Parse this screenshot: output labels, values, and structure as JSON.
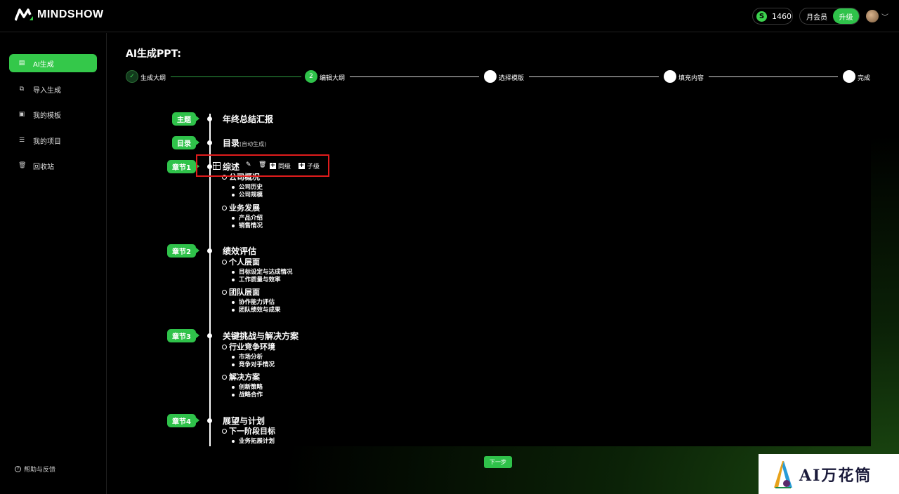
{
  "header": {
    "logo_text": "MINDSHOW",
    "credits": "1460",
    "credit_icon": "S",
    "membership": "月会员",
    "upgrade": "升级"
  },
  "sidebar": {
    "items": [
      {
        "label": "AI生成",
        "icon": "document-icon"
      },
      {
        "label": "导入生成",
        "icon": "import-icon"
      },
      {
        "label": "我的模板",
        "icon": "template-icon"
      },
      {
        "label": "我的项目",
        "icon": "list-icon"
      },
      {
        "label": "回收站",
        "icon": "trash-icon"
      }
    ],
    "help": "帮助与反馈"
  },
  "main": {
    "title": "AI生成PPT:",
    "steps": [
      {
        "label": "生成大纲",
        "mark": "✓",
        "state": "done"
      },
      {
        "label": "编辑大纲",
        "mark": "2",
        "state": "current"
      },
      {
        "label": "选择模版",
        "mark": "",
        "state": "todo"
      },
      {
        "label": "填充内容",
        "mark": "",
        "state": "todo"
      },
      {
        "label": "完成",
        "mark": "",
        "state": "todo"
      }
    ],
    "outline": {
      "topic_tag": "主题",
      "topic": "年终总结汇报",
      "toc_tag": "目录",
      "toc": "目录",
      "toc_note": "(自动生成)",
      "chapters": [
        {
          "tag": "章节1",
          "title": "综述",
          "sections": [
            {
              "title": "公司概况",
              "items": [
                "公司历史",
                "公司规模"
              ]
            },
            {
              "title": "业务发展",
              "items": [
                "产品介绍",
                "销售情况"
              ]
            }
          ]
        },
        {
          "tag": "章节2",
          "title": "绩效评估",
          "sections": [
            {
              "title": "个人层面",
              "items": [
                "目标设定与达成情况",
                "工作质量与效率"
              ]
            },
            {
              "title": "团队层面",
              "items": [
                "协作能力评估",
                "团队绩效与成果"
              ]
            }
          ]
        },
        {
          "tag": "章节3",
          "title": "关键挑战与解决方案",
          "sections": [
            {
              "title": "行业竞争环境",
              "items": [
                "市场分析",
                "竞争对手情况"
              ]
            },
            {
              "title": "解决方案",
              "items": [
                "创新策略",
                "战略合作"
              ]
            }
          ]
        },
        {
          "tag": "章节4",
          "title": "展望与计划",
          "sections": [
            {
              "title": "下一阶段目标",
              "items": [
                "业务拓展计划"
              ]
            }
          ]
        }
      ]
    },
    "toolbar": {
      "same_level": "同级",
      "child_level": "子级"
    },
    "next_button": "下一步"
  },
  "watermark": {
    "text": "AI万花筒"
  },
  "colors": {
    "accent": "#2fc24a",
    "highlight_border": "#e01c1c"
  }
}
